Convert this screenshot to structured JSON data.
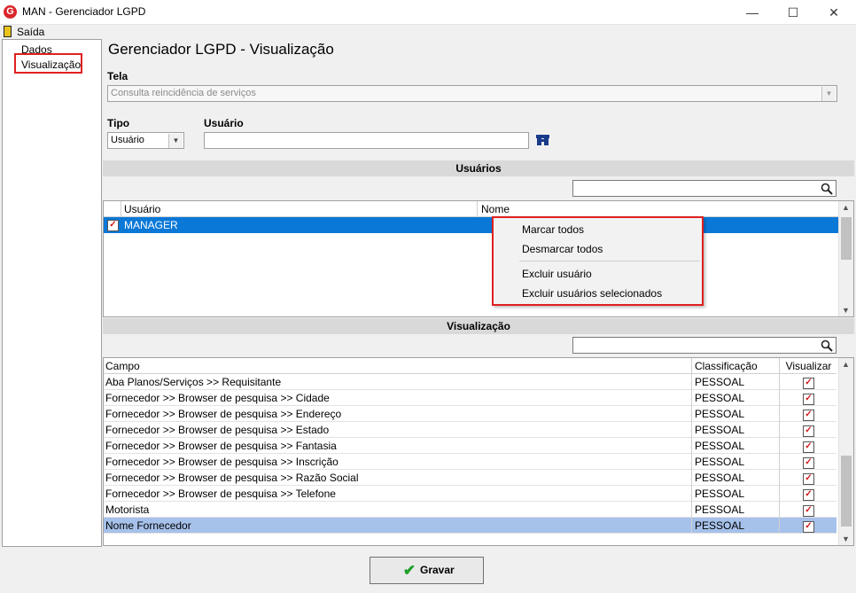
{
  "window": {
    "title": "MAN - Gerenciador LGPD",
    "logo_letter": "G",
    "min": "—",
    "max": "☐",
    "close": "✕"
  },
  "menu": {
    "exit": "Saída"
  },
  "tree": {
    "items": [
      {
        "label": "Dados"
      },
      {
        "label": "Visualização"
      }
    ]
  },
  "main": {
    "title": "Gerenciador LGPD - Visualização",
    "tela_label": "Tela",
    "tela_value": "Consulta reincidência de serviços",
    "tipo_label": "Tipo",
    "tipo_value": "Usuário",
    "usuario_label": "Usuário",
    "usuario_value": ""
  },
  "users_section": {
    "header": "Usuários",
    "search_value": "",
    "col_usuario": "Usuário",
    "col_nome": "Nome",
    "rows": [
      {
        "usuario": "MANAGER",
        "nome": "",
        "checked": true
      }
    ]
  },
  "context_menu": {
    "items": [
      "Marcar todos",
      "Desmarcar todos",
      "Excluir usuário",
      "Excluir usuários selecionados"
    ]
  },
  "vis_section": {
    "header": "Visualização",
    "search_value": "",
    "col_campo": "Campo",
    "col_class": "Classificação",
    "col_vis": "Visualizar",
    "check_glyph": "✓",
    "rows": [
      {
        "campo": "Aba Planos/Serviços >> Requisitante",
        "class": "PESSOAL"
      },
      {
        "campo": "Fornecedor >> Browser de pesquisa >> Cidade",
        "class": "PESSOAL"
      },
      {
        "campo": "Fornecedor >> Browser de pesquisa >> Endereço",
        "class": "PESSOAL"
      },
      {
        "campo": "Fornecedor >> Browser de pesquisa >> Estado",
        "class": "PESSOAL"
      },
      {
        "campo": "Fornecedor >> Browser de pesquisa >> Fantasia",
        "class": "PESSOAL"
      },
      {
        "campo": "Fornecedor >> Browser de pesquisa >> Inscrição",
        "class": "PESSOAL"
      },
      {
        "campo": "Fornecedor >> Browser de pesquisa >> Razão Social",
        "class": "PESSOAL"
      },
      {
        "campo": "Fornecedor >> Browser de pesquisa >> Telefone",
        "class": "PESSOAL"
      },
      {
        "campo": "Motorista",
        "class": "PESSOAL"
      },
      {
        "campo": "Nome Fornecedor",
        "class": "PESSOAL"
      }
    ]
  },
  "footer": {
    "save_label": "Gravar"
  },
  "icons": {
    "search": "search-icon",
    "binoculars": "binoculars-icon",
    "check": "check-icon",
    "exit": "exit-icon"
  }
}
